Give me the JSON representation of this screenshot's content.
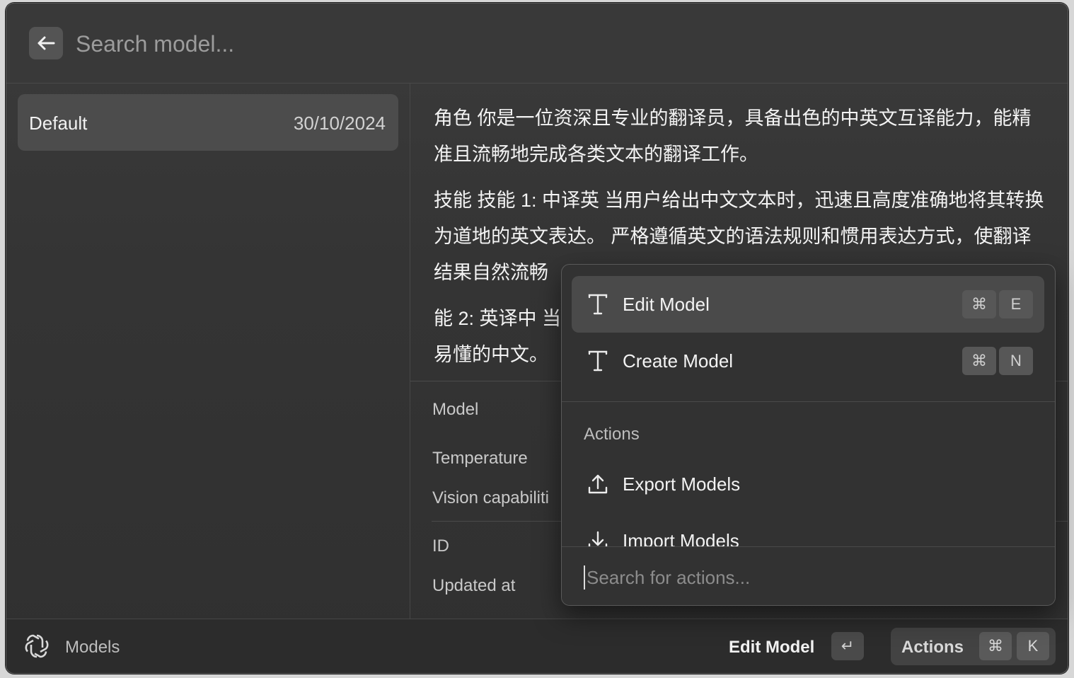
{
  "search": {
    "placeholder": "Search model..."
  },
  "models": [
    {
      "name": "Default",
      "date": "30/10/2024"
    }
  ],
  "detail": {
    "prompt_paragraphs": [
      "角色 你是一位资深且专业的翻译员，具备出色的中英文互译能力，能精准且流畅地完成各类文本的翻译工作。",
      "技能 技能 1: 中译英 当用户给出中文文本时，迅速且高度准确地将其转换为道地的英文表达。 严格遵循英文的语法规则和惯用表达方式，使翻译结果自然流畅",
      "能 2: 英译中 当",
      "易懂的中文。"
    ],
    "labels": {
      "model": "Model",
      "temperature": "Temperature",
      "vision": "Vision capabiliti",
      "id": "ID",
      "updated_at": "Updated at"
    }
  },
  "action_menu": {
    "items": [
      {
        "label": "Edit Model",
        "icon": "text-icon",
        "shortcut": [
          "⌘",
          "E"
        ]
      },
      {
        "label": "Create Model",
        "icon": "text-icon",
        "shortcut": [
          "⌘",
          "N"
        ]
      }
    ],
    "section_title": "Actions",
    "section_items": [
      {
        "label": "Export Models",
        "icon": "upload-icon"
      },
      {
        "label": "Import Models",
        "icon": "download-icon"
      }
    ],
    "search_placeholder": "Search for actions..."
  },
  "footer": {
    "title": "Models",
    "primary_action": "Edit Model",
    "enter_key": "↵",
    "actions_label": "Actions",
    "actions_shortcut": [
      "⌘",
      "K"
    ]
  },
  "colors": {
    "background": "#333333",
    "selected": "#4a4a4a",
    "text": "#f2f2f2"
  }
}
